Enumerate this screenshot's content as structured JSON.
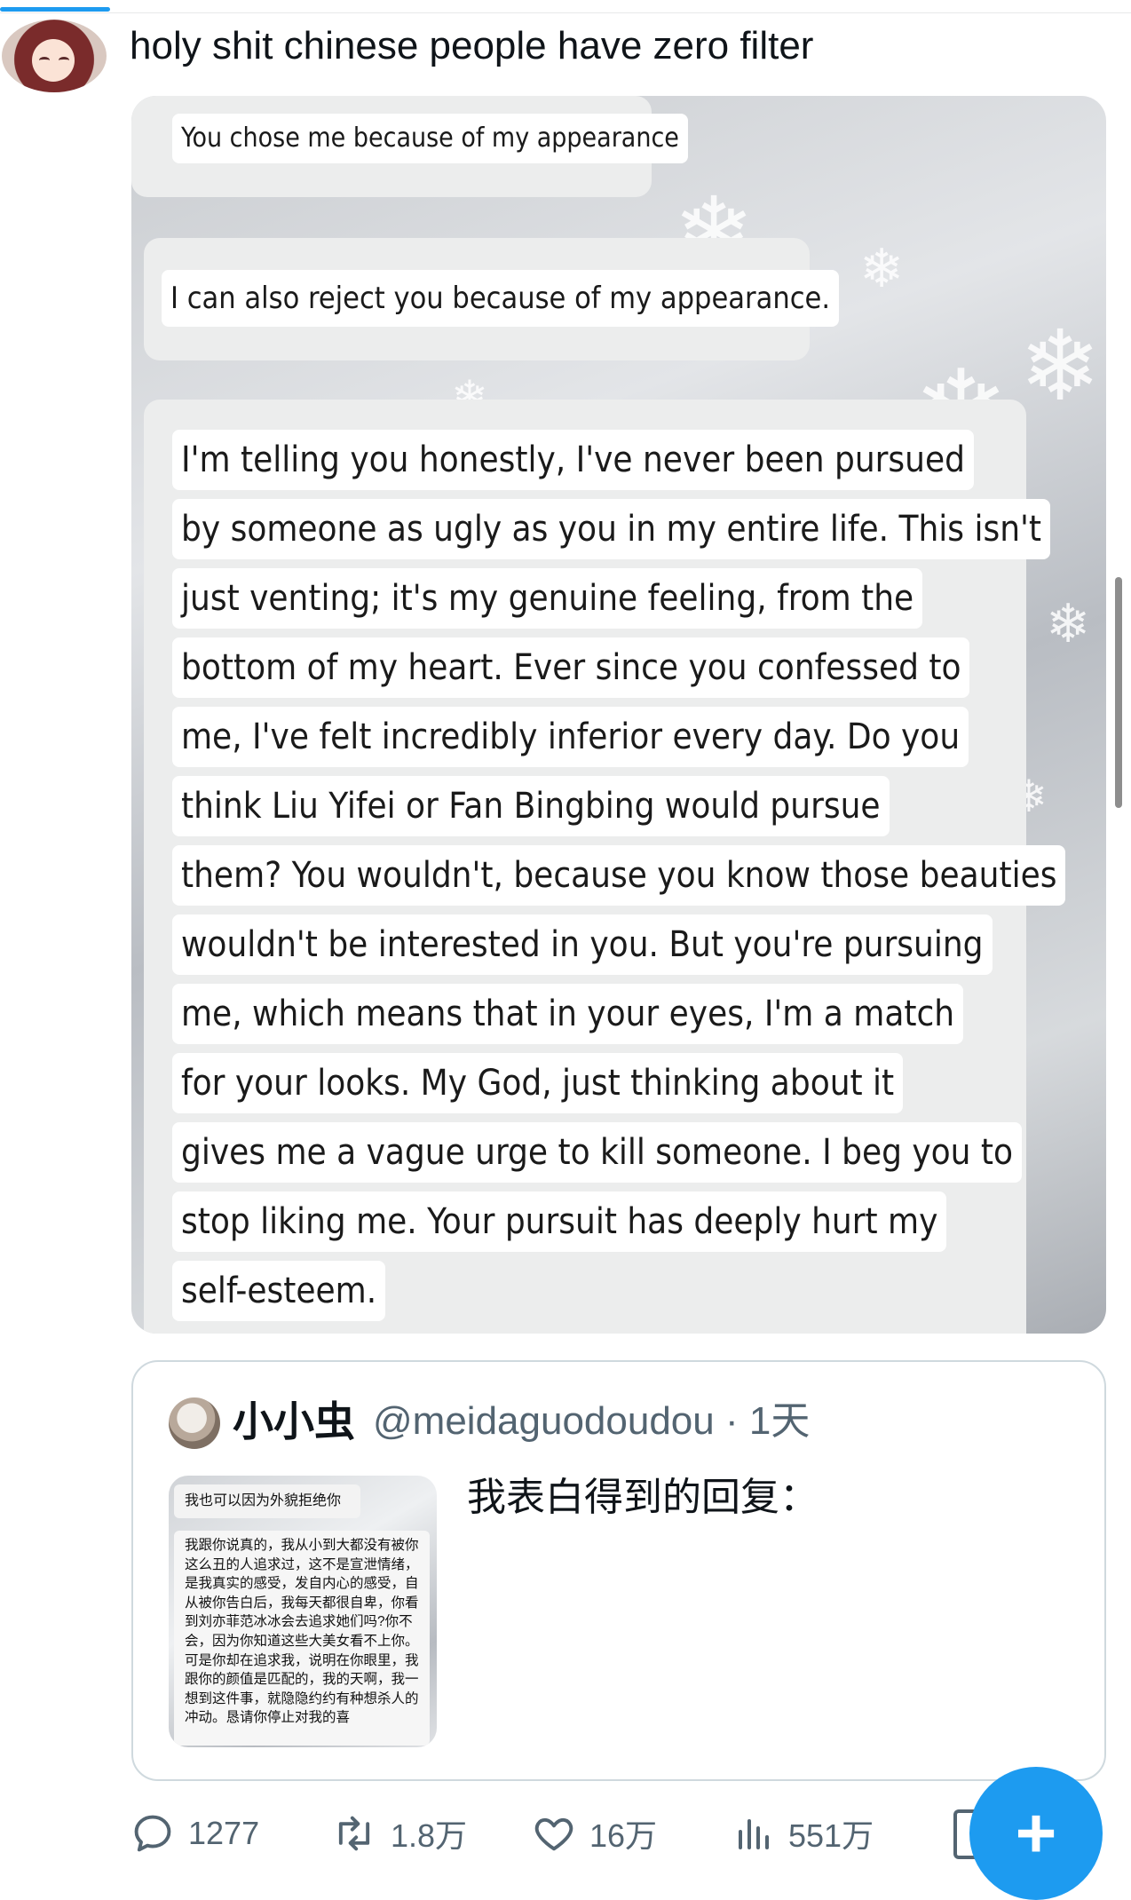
{
  "tweet": {
    "text": "holy shit chinese people have zero filter"
  },
  "media": {
    "bubble_1": "You chose me because of my appearance",
    "bubble_2": "I can also reject you because of my appearance.",
    "message_lines": [
      "I'm telling you honestly, I've never been pursued",
      "by someone as ugly as you in my entire life. This isn't",
      "just venting; it's my genuine feeling, from the",
      "bottom of my heart. Ever since you confessed to",
      "me, I've felt incredibly inferior every day. Do you",
      "think Liu Yifei or Fan Bingbing would pursue",
      "them? You wouldn't, because you know those beauties",
      "wouldn't be interested in you. But you're pursuing",
      "me, which means that in your eyes, I'm a match",
      "for your looks. My God, just thinking about it",
      "gives me a vague urge to kill someone. I beg you to",
      "stop liking me. Your pursuit has deeply hurt my",
      "self-esteem."
    ]
  },
  "quote": {
    "name": "小小虫",
    "handle_time": "@meidaguodoudou · 1天",
    "text": "我表白得到的回复：",
    "thumb_header": "我也可以因为外貌拒绝你",
    "thumb_body": "我跟你说真的，我从小到大都没有被你这么丑的人追求过，这不是宣泄情绪，是我真实的感受，发自内心的感受，自从被你告白后，我每天都很自卑，你看到刘亦菲范冰冰会去追求她们吗?你不会，因为你知道这些大美女看不上你。可是你却在追求我，说明在你眼里，我跟你的颜值是匹配的，我的天啊，我一想到这件事，就隐隐约约有种想杀人的冲动。恳请你停止对我的喜"
  },
  "actions": {
    "replies": "1277",
    "reposts": "1.8万",
    "likes": "16万",
    "views": "551万"
  },
  "fab_label": "+",
  "side_button_label": "*",
  "colors": {
    "accent": "#1d9bf0",
    "secondary_text": "#536471",
    "border": "#cfd9de"
  }
}
